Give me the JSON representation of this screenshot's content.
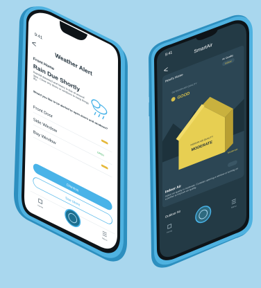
{
  "left_phone": {
    "status_time": "9:41",
    "header_title": "Weather Alert",
    "nav_back": "<",
    "location_label": "Front Home",
    "alert_title": "Rain Due Shortly",
    "alert_body": "Rainfall detected and heavy is due at around 3pm. Close any doors or windows to keep things dry.",
    "question": "Would you like to be alerted to open doors and windows?",
    "sensors": [
      {
        "name": "Front Door",
        "status": ""
      },
      {
        "name": "Side Window",
        "status": "OPEN"
      },
      {
        "name": "Bay Window",
        "status": ""
      }
    ],
    "primary_button": "Dismiss",
    "secondary_button": "See More",
    "tab_left": "Home",
    "tab_right": "Menu",
    "colors": {
      "accent": "#49b3e8",
      "status_green": "#2fae55",
      "status_amber": "#e5b93b"
    }
  },
  "right_phone": {
    "status_time": "9:41",
    "header_title": "SmartAir",
    "nav_back": "<",
    "section_label": "Howl's Home",
    "top_right_label": "Air Quality",
    "top_right_value": "Indoor",
    "air_quality_small_label": "OUTDOOR AIR QUALITY",
    "air_quality_value": "GOOD",
    "house_label_small": "INDOOR AIR QUALITY",
    "house_label_value": "MODERATE",
    "side_label": "Moderate",
    "info_title": "Indoor Air",
    "info_body": "Indoor air quality is moderate. Consider opening a window or turning on a purifier to improve air quality.",
    "bottom_label": "Outdoor Air",
    "tab_left": "Home",
    "tab_right": "Menu",
    "colors": {
      "screen_bg": "#233a45",
      "house_fill": "#e7cf52",
      "accent_gold": "#d8c04b"
    }
  }
}
